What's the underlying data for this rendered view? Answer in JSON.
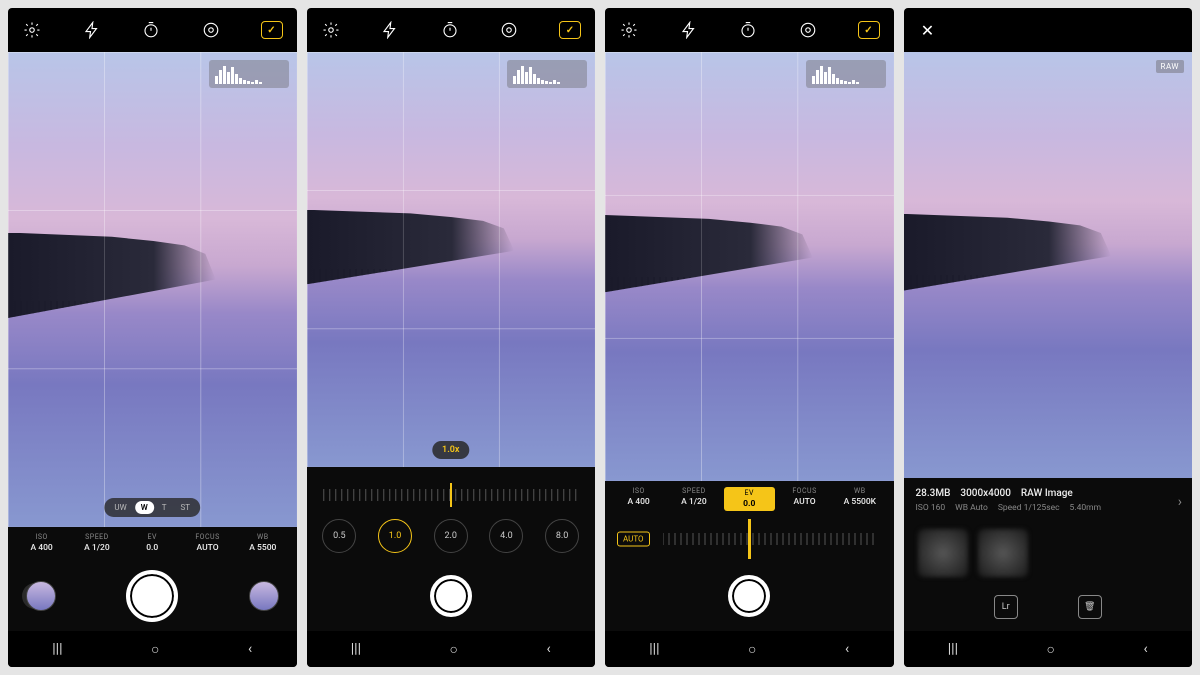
{
  "topbar_icons": [
    "settings",
    "flash",
    "timer",
    "metering",
    "histogram-toggle"
  ],
  "screen1": {
    "zoom_options": [
      "UW",
      "W",
      "T",
      "ST"
    ],
    "zoom_active": "W",
    "params": [
      {
        "label": "ISO",
        "value": "A 400"
      },
      {
        "label": "SPEED",
        "value": "A 1/20"
      },
      {
        "label": "EV",
        "value": "0.0"
      },
      {
        "label": "FOCUS",
        "value": "AUTO"
      },
      {
        "label": "WB",
        "value": "A 5500"
      }
    ]
  },
  "screen2": {
    "zoom_readout": "1.0x",
    "zoom_steps": [
      "0.5",
      "1.0",
      "2.0",
      "4.0",
      "8.0"
    ],
    "zoom_selected": "1.0"
  },
  "screen3": {
    "params": [
      {
        "label": "ISO",
        "value": "A 400"
      },
      {
        "label": "SPEED",
        "value": "A 1/20"
      },
      {
        "label": "EV",
        "value": "0.0",
        "active": true
      },
      {
        "label": "FOCUS",
        "value": "AUTO"
      },
      {
        "label": "WB",
        "value": "A 5500K"
      }
    ],
    "auto_label": "AUTO"
  },
  "screen4": {
    "close_label": "✕",
    "raw_badge": "RAW",
    "filesize": "28.3MB",
    "dimensions": "3000x4000",
    "format": "RAW Image",
    "meta_iso": "ISO 160",
    "meta_wb": "WB Auto",
    "meta_speed": "Speed 1/125sec",
    "meta_focal": "5.40mm",
    "lr_label": "Lr",
    "delete_label": "🗑"
  },
  "nav": {
    "recents": "|||",
    "home": "○",
    "back": "‹"
  }
}
